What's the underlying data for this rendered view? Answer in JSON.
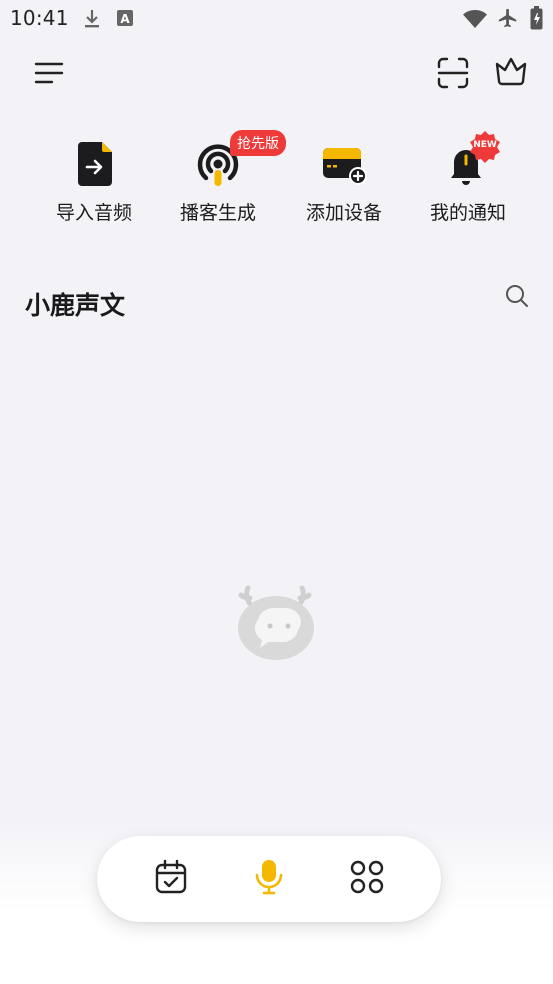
{
  "status_bar": {
    "time": "10:41",
    "icons": [
      "download-icon",
      "keyboard-a-icon",
      "wifi-icon",
      "airplane-icon",
      "battery-icon"
    ]
  },
  "header": {
    "menu_icon": "menu-icon",
    "scan_icon": "scan-icon",
    "crown_icon": "crown-icon"
  },
  "quick_actions": [
    {
      "label": "导入音频",
      "icon": "import-audio-icon"
    },
    {
      "label": "播客生成",
      "icon": "podcast-icon",
      "badge": "抢先版"
    },
    {
      "label": "添加设备",
      "icon": "add-device-icon"
    },
    {
      "label": "我的通知",
      "icon": "notification-bell-icon",
      "badge": "NEW"
    }
  ],
  "section": {
    "title": "小鹿声文",
    "search_icon": "search-icon"
  },
  "empty_state": {
    "icon": "deer-mascot-icon"
  },
  "bottom_nav": {
    "items": [
      "calendar-check-icon",
      "microphone-icon",
      "apps-grid-icon"
    ],
    "active_color": "#f5b800"
  },
  "colors": {
    "accent": "#f5b800",
    "badge_red": "#ef3a3a",
    "icon_dark": "#1c1c1e"
  }
}
